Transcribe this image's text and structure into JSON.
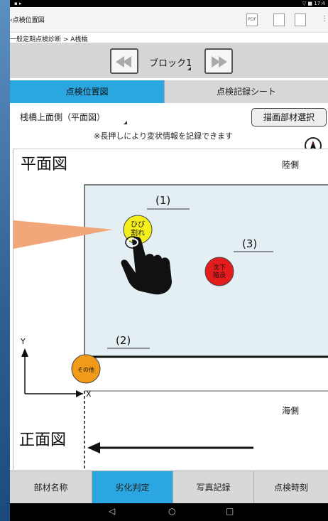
{
  "status": {
    "right": "▽ ■ 17:4"
  },
  "app": {
    "title": "点検位置図",
    "back_glyph": "‹"
  },
  "toolbar": {
    "pdf_label": "PDF"
  },
  "breadcrumb": "一般定期点検診断 > A桟橋",
  "block": {
    "label": "ブロック1"
  },
  "tabs": [
    {
      "label": "点検位置図",
      "active": true
    },
    {
      "label": "点検記録シート",
      "active": false
    }
  ],
  "view": {
    "selected": "桟橋上面側（平面図）",
    "select_button": "描画部材選択"
  },
  "hint": "※長押しにより変状情報を記録できます",
  "drawing": {
    "plan_title": "平面図",
    "front_title": "正面図",
    "land_side": "陸側",
    "sea_side": "海側",
    "axis_y": "Y",
    "axis_x": "X",
    "compass_letter": "N",
    "markers": [
      {
        "number": "(1)",
        "text": [
          "ひび",
          "割れ"
        ],
        "color": "#f4ee1c"
      },
      {
        "number": "(2)",
        "text": [
          "その他"
        ],
        "color": "#f29a1a"
      },
      {
        "number": "(3)",
        "text": [
          "沈下",
          "陥没"
        ],
        "color": "#e51c1c"
      }
    ]
  },
  "bottom_nav": [
    {
      "label": "部材名称",
      "active": false
    },
    {
      "label": "劣化判定",
      "active": true
    },
    {
      "label": "写真記録",
      "active": false
    },
    {
      "label": "点検時刻",
      "active": false
    }
  ],
  "android_nav": {
    "back": "◁",
    "home": "○",
    "recent": "□"
  },
  "colors": {
    "accent": "#2aa6e0",
    "plan_fill": "#e4eff3",
    "pointer": "#f2a77a"
  }
}
